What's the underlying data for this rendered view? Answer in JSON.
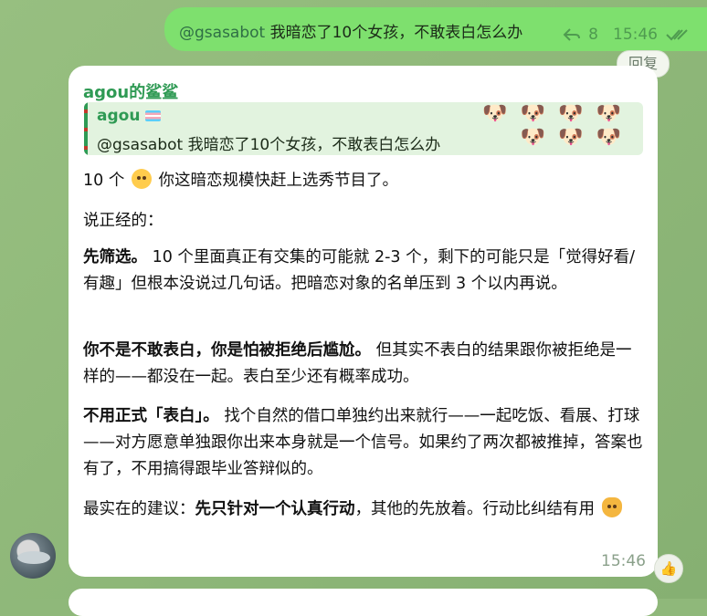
{
  "outgoing": {
    "mention": "@gsasabot",
    "text": " 我暗恋了10个女孩，不敢表白怎么办",
    "reply_count": "8",
    "time": "15:46",
    "reply_chip": "回复"
  },
  "incoming": {
    "sender": "agou的鲨鲨",
    "quote": {
      "name": "agou",
      "text": "@gsasabot 我暗恋了10个女孩，不敢表白怎么办"
    },
    "p1": {
      "before": "10 个",
      "after": " 你这暗恋规模快赶上选秀节目了。"
    },
    "p2": "说正经的：",
    "p3": {
      "bold": "先筛选。",
      "text": " 10 个里面真正有交集的可能就 2-3 个，剩下的可能只是「觉得好看/有趣」但根本没说过几句话。把暗恋对象的名单压到 3 个以内再说。"
    },
    "p4": {
      "bold": "你不是不敢表白，你是怕被拒绝后尴尬。",
      "text": " 但其实不表白的结果跟你被拒绝是一样的——都没在一起。表白至少还有概率成功。"
    },
    "p5": {
      "bold": "不用正式「表白」。",
      "text": " 找个自然的借口单独约出来就行——一起吃饭、看展、打球——对方愿意单独跟你出来本身就是一个信号。如果约了两次都被推掉，答案也有了，不用搞得跟毕业答辩似的。"
    },
    "p6": {
      "before": "最实在的建议：",
      "bold": "先只针对一个认真行动",
      "after": "，其他的先放着。行动比纠结有用"
    },
    "time": "15:46",
    "reaction": "👍",
    "emoji_1": "crying-laughing-cat-emoji",
    "emoji_2": "cat-emoji"
  },
  "colors": {
    "outgoing_bubble": "#7ee06e",
    "sender_name": "#2f9a54",
    "quote_bg": "#e2f3df"
  }
}
